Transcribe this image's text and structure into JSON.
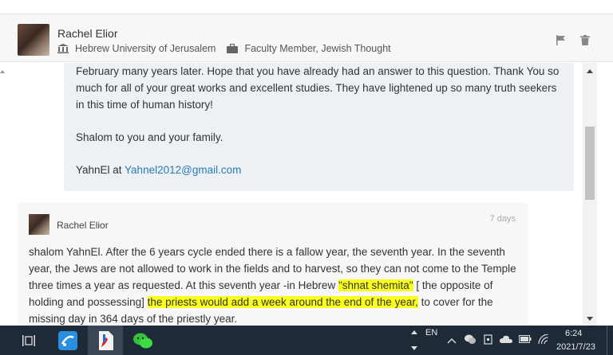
{
  "header": {
    "author_name": "Rachel Elior",
    "institution": "Hebrew University of Jerusalem",
    "position": "Faculty Member, Jewish Thought",
    "icons": [
      "flag-icon",
      "trash-icon"
    ]
  },
  "message1": {
    "paragraph1": "February many years later. Hope that you have already had an answer to this question. Thank You so much for all of your great works and excellent studies. They have lightened up so many truth seekers in this time of human history!",
    "paragraph2": "Shalom to you and your family.",
    "signature_prefix": "YahnEl at ",
    "email": "Yahnel2012@gmail.com"
  },
  "message2": {
    "author_name": "Rachel Elior",
    "time": "7 days",
    "text_part1": "shalom YahnEl. After the 6 years cycle ended there is a fallow year, the seventh year. In the seventh year, the Jews are not allowed to work in the fields and to harvest, so they can not come to the Temple three times a year as requested. At this seventh year -in Hebrew ",
    "highlight1": "\"shnat shemita\"",
    "text_part2": " [ the opposite of holding and possessing] ",
    "highlight2": "the priests would add a week around the end of the year,",
    "text_part3": " to cover for the missing day in 364 days of the priestly year."
  },
  "taskbar": {
    "language": "EN",
    "clock_time": "6:24",
    "clock_date": "2021/7/23",
    "apps": [
      "task-view-icon",
      "feedback-app-icon",
      "pdf-app-icon",
      "wechat-icon"
    ]
  },
  "colors": {
    "link": "#2a7ab6",
    "highlight": "#fbff1e",
    "taskbar": "#1f2a38"
  }
}
